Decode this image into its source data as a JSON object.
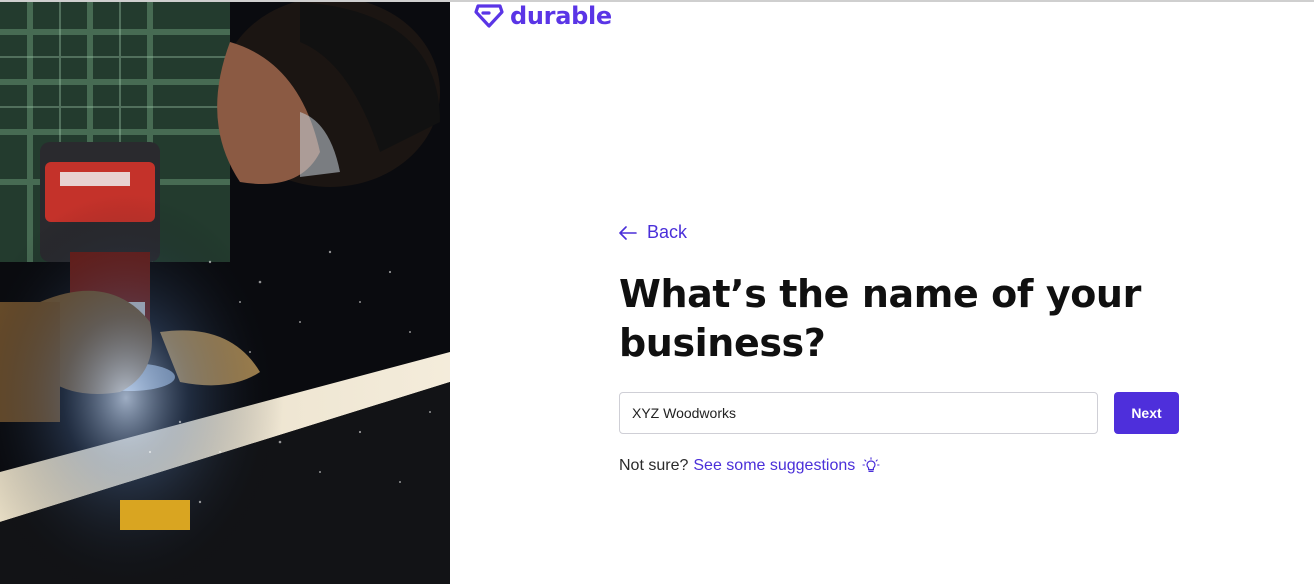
{
  "brand": {
    "name": "durable",
    "color": "#5a35e6",
    "icon": "durable-diamond-icon"
  },
  "hero": {
    "image": "craftsman-with-router-photo"
  },
  "form": {
    "back_label": "Back",
    "back_icon": "arrow-left-icon",
    "headline": "What’s the name of your business?",
    "input_value": "XYZ Woodworks",
    "next_label": "Next",
    "not_sure_text": "Not sure?",
    "suggestions_link": "See some suggestions",
    "suggestions_icon": "lightbulb-icon"
  },
  "colors": {
    "accent": "#4e2fdb",
    "text": "#101010"
  }
}
